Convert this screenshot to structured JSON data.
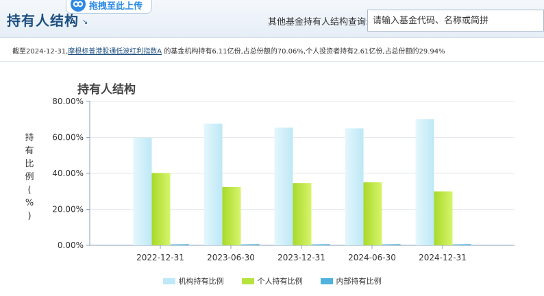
{
  "header": {
    "title": "持有人结构",
    "upload_label": "拖拽至此上传",
    "search_label": "其他基金持有人结构查询:",
    "search_placeholder": "请输入基金代码、名称或简拼"
  },
  "summary": {
    "prefix": "截至2024-12-31,",
    "fund_name": "摩根标普港股通低波红利指数A",
    "suffix": " 的基金机构持有6.11亿份,占总份额的70.06%,个人投资者持有2.61亿份,占总份额的29.94%"
  },
  "colors": {
    "institution": "#bfe9f7",
    "individual": "#b7e33d",
    "insider": "#4fb3dd"
  },
  "chart_data": {
    "type": "bar",
    "title": "持有人结构",
    "ylabel": "持有比例(%)",
    "categories": [
      "2022-12-31",
      "2023-06-30",
      "2023-12-31",
      "2024-06-30",
      "2024-12-31"
    ],
    "y_ticks": [
      "0.00%",
      "20.00%",
      "40.00%",
      "60.00%",
      "80.00%"
    ],
    "ylim": [
      0,
      80
    ],
    "grid": true,
    "legend": "bottom",
    "series": [
      {
        "name": "机构持有比例",
        "values": [
          59.8,
          67.6,
          65.4,
          65.0,
          70.06
        ]
      },
      {
        "name": "个人持有比例",
        "values": [
          40.2,
          32.4,
          34.6,
          35.0,
          29.94
        ]
      },
      {
        "name": "内部持有比例",
        "values": [
          0.2,
          0.2,
          0.2,
          0.2,
          0.2
        ]
      }
    ]
  }
}
